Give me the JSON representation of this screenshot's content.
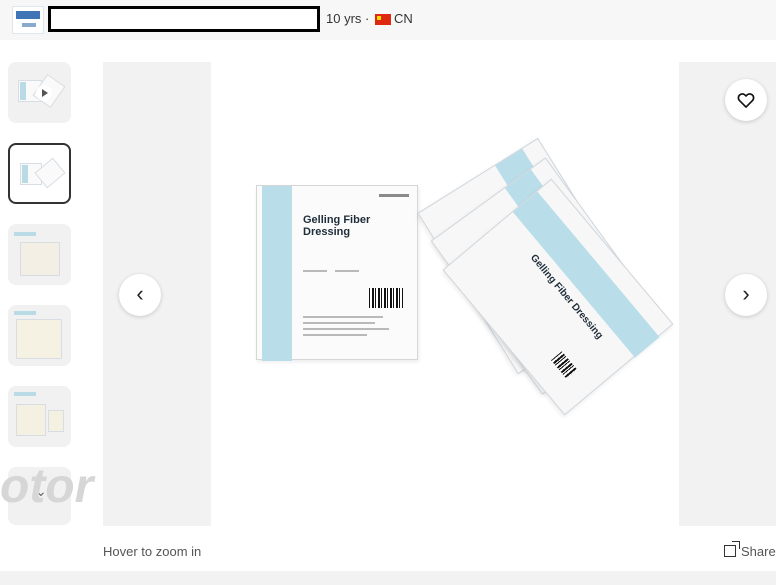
{
  "supplier": {
    "years": "10 yrs",
    "separator": " · ",
    "country": "CN",
    "country_flag_color": "#de2910"
  },
  "gallery": {
    "thumbnail_count": 6,
    "selected_thumbnail": 2
  },
  "product": {
    "name": "Gelling Fiber Dressing"
  },
  "controls": {
    "favorite_icon": "heart-outline-icon",
    "prev_icon": "chevron-left-icon",
    "next_icon": "chevron-right-icon",
    "prev_glyph": "‹",
    "next_glyph": "›"
  },
  "watermark": "otor",
  "hint": "Hover to zoom in",
  "share_label": "Share",
  "colors": {
    "accent_blue": "#b9dde9",
    "panel_gray": "#f2f2f2"
  }
}
